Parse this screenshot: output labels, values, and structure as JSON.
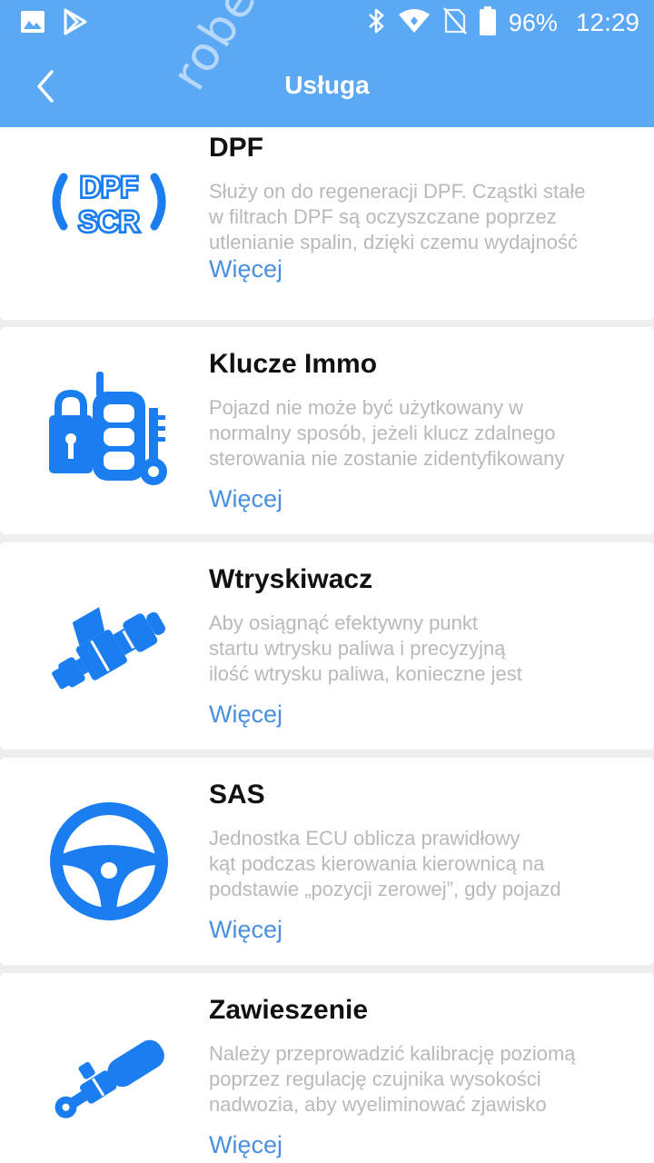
{
  "status_bar": {
    "battery": "96%",
    "time": "12:29"
  },
  "app_bar": {
    "title": "Usługa"
  },
  "watermark": "robert",
  "colors": {
    "primary": "#5ba8f5",
    "icon_blue": "#1a7ef0",
    "link": "#4a90e2",
    "desc_text": "#b9b9b9"
  },
  "services": [
    {
      "title": "DPF",
      "icon": "dpf-scr-icon",
      "desc": [
        "Służy on do regeneracji DPF. Cząstki stałe",
        "w filtrach DPF są oczyszczane poprzez",
        "utlenianie spalin, dzięki czemu wydajność"
      ],
      "more": "Więcej"
    },
    {
      "title": "Klucze Immo",
      "icon": "immo-key-icon",
      "desc": [
        "Pojazd nie może być użytkowany w",
        "normalny sposób, jeżeli klucz zdalnego",
        "sterowania nie zostanie zidentyfikowany"
      ],
      "more": "Więcej"
    },
    {
      "title": "Wtryskiwacz",
      "icon": "injector-icon",
      "desc": [
        "Aby osiągnąć efektywny punkt",
        "startu wtrysku paliwa i precyzyjną",
        "ilość wtrysku paliwa, konieczne jest"
      ],
      "more": "Więcej"
    },
    {
      "title": "SAS",
      "icon": "steering-wheel-icon",
      "desc": [
        "Jednostka ECU oblicza prawidłowy",
        "kąt podczas kierowania kierownicą na",
        "podstawie „pozycji zerowej”, gdy pojazd"
      ],
      "more": "Więcej"
    },
    {
      "title": "Zawieszenie",
      "icon": "suspension-sensor-icon",
      "desc": [
        "Należy przeprowadzić kalibrację poziomą",
        "poprzez regulację czujnika wysokości",
        "nadwozia, aby wyeliminować zjawisko"
      ],
      "more": "Więcej"
    }
  ]
}
